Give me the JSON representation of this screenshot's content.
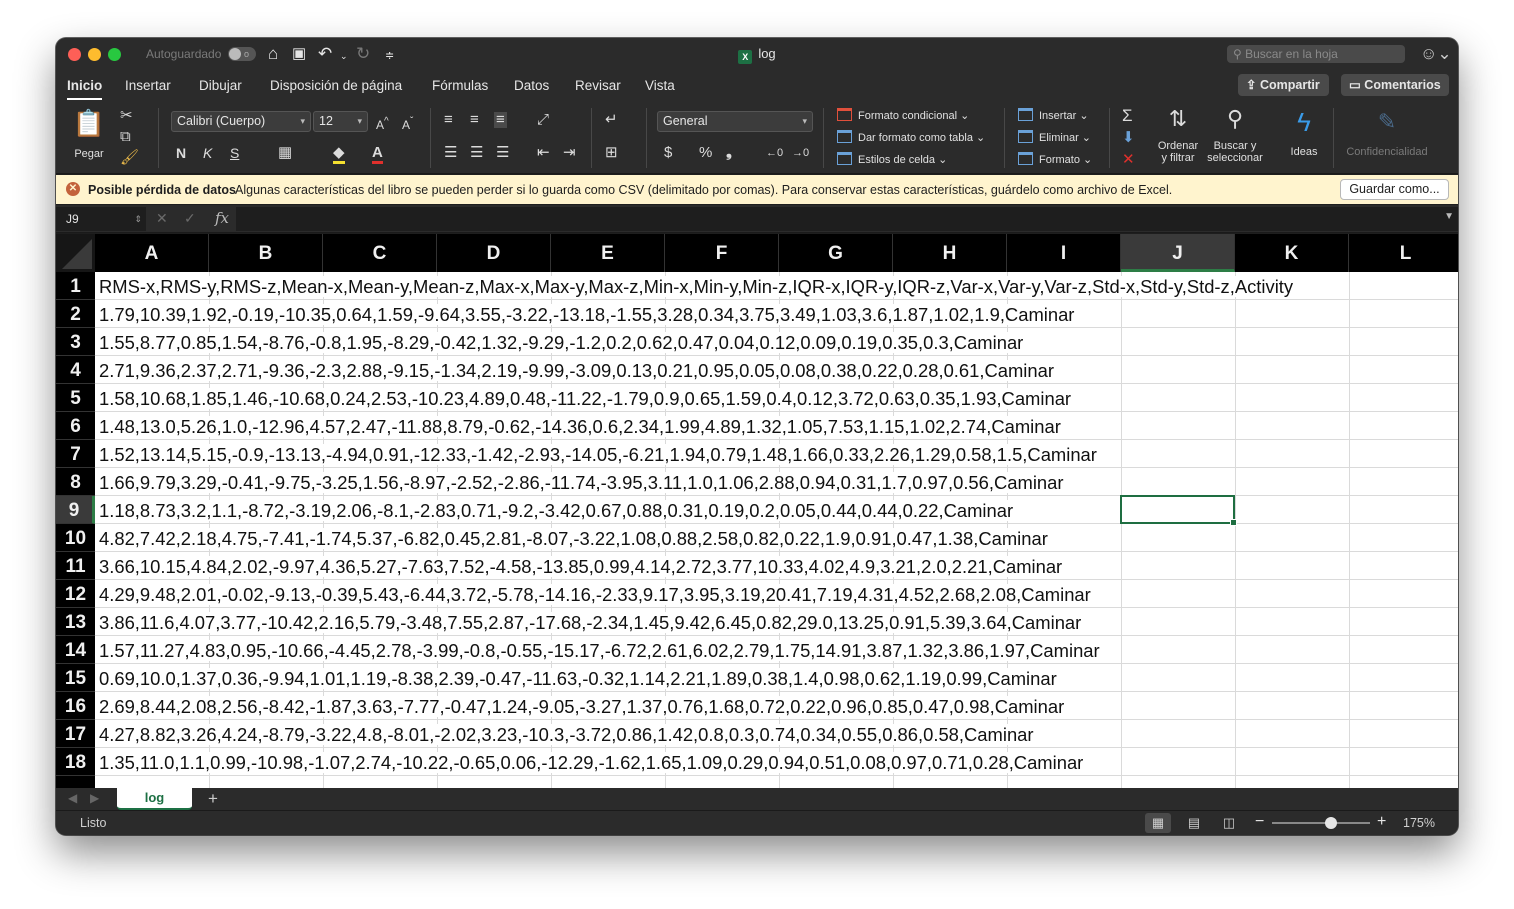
{
  "window": {
    "title": "log",
    "autosave_label": "Autoguardado",
    "autosave_state": "o",
    "search_placeholder": "Buscar en la hoja"
  },
  "tabs": [
    "Inicio",
    "Insertar",
    "Dibujar",
    "Disposición de página",
    "Fórmulas",
    "Datos",
    "Revisar",
    "Vista"
  ],
  "active_tab": "Inicio",
  "actions": {
    "share": "Compartir",
    "comments": "Comentarios"
  },
  "ribbon": {
    "paste": "Pegar",
    "font_name": "Calibri (Cuerpo)",
    "font_size": "12",
    "bold": "N",
    "italic": "K",
    "underline": "S",
    "number_format": "General",
    "conditional_format": "Formato condicional",
    "format_as_table": "Dar formato como tabla",
    "cell_styles": "Estilos de celda",
    "insert": "Insertar",
    "delete": "Eliminar",
    "format": "Formato",
    "sort_filter_1": "Ordenar",
    "sort_filter_2": "y filtrar",
    "find_select_1": "Buscar y",
    "find_select_2": "seleccionar",
    "ideas": "Ideas",
    "confidentiality": "Confidencialidad"
  },
  "message_bar": {
    "title": "Posible pérdida de datos",
    "text": "Algunas características del libro se pueden perder si lo guarda como CSV (delimitado por comas). Para conservar estas características, guárdelo como archivo de Excel.",
    "button": "Guardar como..."
  },
  "formula_bar": {
    "name_box": "J9",
    "content": ""
  },
  "columns": [
    "A",
    "B",
    "C",
    "D",
    "E",
    "F",
    "G",
    "H",
    "I",
    "J",
    "K",
    "L"
  ],
  "selected_cell": "J9",
  "rows": [
    {
      "n": "1",
      "text": "RMS-x,RMS-y,RMS-z,Mean-x,Mean-y,Mean-z,Max-x,Max-y,Max-z,Min-x,Min-y,Min-z,IQR-x,IQR-y,IQR-z,Var-x,Var-y,Var-z,Std-x,Std-y,Std-z,Activity"
    },
    {
      "n": "2",
      "text": "1.79,10.39,1.92,-0.19,-10.35,0.64,1.59,-9.64,3.55,-3.22,-13.18,-1.55,3.28,0.34,3.75,3.49,1.03,3.6,1.87,1.02,1.9,Caminar"
    },
    {
      "n": "3",
      "text": "1.55,8.77,0.85,1.54,-8.76,-0.8,1.95,-8.29,-0.42,1.32,-9.29,-1.2,0.2,0.62,0.47,0.04,0.12,0.09,0.19,0.35,0.3,Caminar"
    },
    {
      "n": "4",
      "text": "2.71,9.36,2.37,2.71,-9.36,-2.3,2.88,-9.15,-1.34,2.19,-9.99,-3.09,0.13,0.21,0.95,0.05,0.08,0.38,0.22,0.28,0.61,Caminar"
    },
    {
      "n": "5",
      "text": "1.58,10.68,1.85,1.46,-10.68,0.24,2.53,-10.23,4.89,0.48,-11.22,-1.79,0.9,0.65,1.59,0.4,0.12,3.72,0.63,0.35,1.93,Caminar"
    },
    {
      "n": "6",
      "text": "1.48,13.0,5.26,1.0,-12.96,4.57,2.47,-11.88,8.79,-0.62,-14.36,0.6,2.34,1.99,4.89,1.32,1.05,7.53,1.15,1.02,2.74,Caminar"
    },
    {
      "n": "7",
      "text": "1.52,13.14,5.15,-0.9,-13.13,-4.94,0.91,-12.33,-1.42,-2.93,-14.05,-6.21,1.94,0.79,1.48,1.66,0.33,2.26,1.29,0.58,1.5,Caminar"
    },
    {
      "n": "8",
      "text": "1.66,9.79,3.29,-0.41,-9.75,-3.25,1.56,-8.97,-2.52,-2.86,-11.74,-3.95,3.11,1.0,1.06,2.88,0.94,0.31,1.7,0.97,0.56,Caminar"
    },
    {
      "n": "9",
      "text": "1.18,8.73,3.2,1.1,-8.72,-3.19,2.06,-8.1,-2.83,0.71,-9.2,-3.42,0.67,0.88,0.31,0.19,0.2,0.05,0.44,0.44,0.22,Caminar"
    },
    {
      "n": "10",
      "text": "4.82,7.42,2.18,4.75,-7.41,-1.74,5.37,-6.82,0.45,2.81,-8.07,-3.22,1.08,0.88,2.58,0.82,0.22,1.9,0.91,0.47,1.38,Caminar"
    },
    {
      "n": "11",
      "text": "3.66,10.15,4.84,2.02,-9.97,4.36,5.27,-7.63,7.52,-4.58,-13.85,0.99,4.14,2.72,3.77,10.33,4.02,4.9,3.21,2.0,2.21,Caminar"
    },
    {
      "n": "12",
      "text": "4.29,9.48,2.01,-0.02,-9.13,-0.39,5.43,-6.44,3.72,-5.78,-14.16,-2.33,9.17,3.95,3.19,20.41,7.19,4.31,4.52,2.68,2.08,Caminar"
    },
    {
      "n": "13",
      "text": "3.86,11.6,4.07,3.77,-10.42,2.16,5.79,-3.48,7.55,2.87,-17.68,-2.34,1.45,9.42,6.45,0.82,29.0,13.25,0.91,5.39,3.64,Caminar"
    },
    {
      "n": "14",
      "text": "1.57,11.27,4.83,0.95,-10.66,-4.45,2.78,-3.99,-0.8,-0.55,-15.17,-6.72,2.61,6.02,2.79,1.75,14.91,3.87,1.32,3.86,1.97,Caminar"
    },
    {
      "n": "15",
      "text": "0.69,10.0,1.37,0.36,-9.94,1.01,1.19,-8.38,2.39,-0.47,-11.63,-0.32,1.14,2.21,1.89,0.38,1.4,0.98,0.62,1.19,0.99,Caminar"
    },
    {
      "n": "16",
      "text": "2.69,8.44,2.08,2.56,-8.42,-1.87,3.63,-7.77,-0.47,1.24,-9.05,-3.27,1.37,0.76,1.68,0.72,0.22,0.96,0.85,0.47,0.98,Caminar"
    },
    {
      "n": "17",
      "text": "4.27,8.82,3.26,4.24,-8.79,-3.22,4.8,-8.01,-2.02,3.23,-10.3,-3.72,0.86,1.42,0.8,0.3,0.74,0.34,0.55,0.86,0.58,Caminar"
    },
    {
      "n": "18",
      "text": "1.35,11.0,1.1,0.99,-10.98,-1.07,2.74,-10.22,-0.65,0.06,-12.29,-1.62,1.65,1.09,0.29,0.94,0.51,0.08,0.97,0.71,0.28,Caminar"
    }
  ],
  "sheet_tabs": [
    "log"
  ],
  "status": {
    "text": "Listo",
    "zoom": "175%",
    "zoom_fraction": 0.6
  }
}
